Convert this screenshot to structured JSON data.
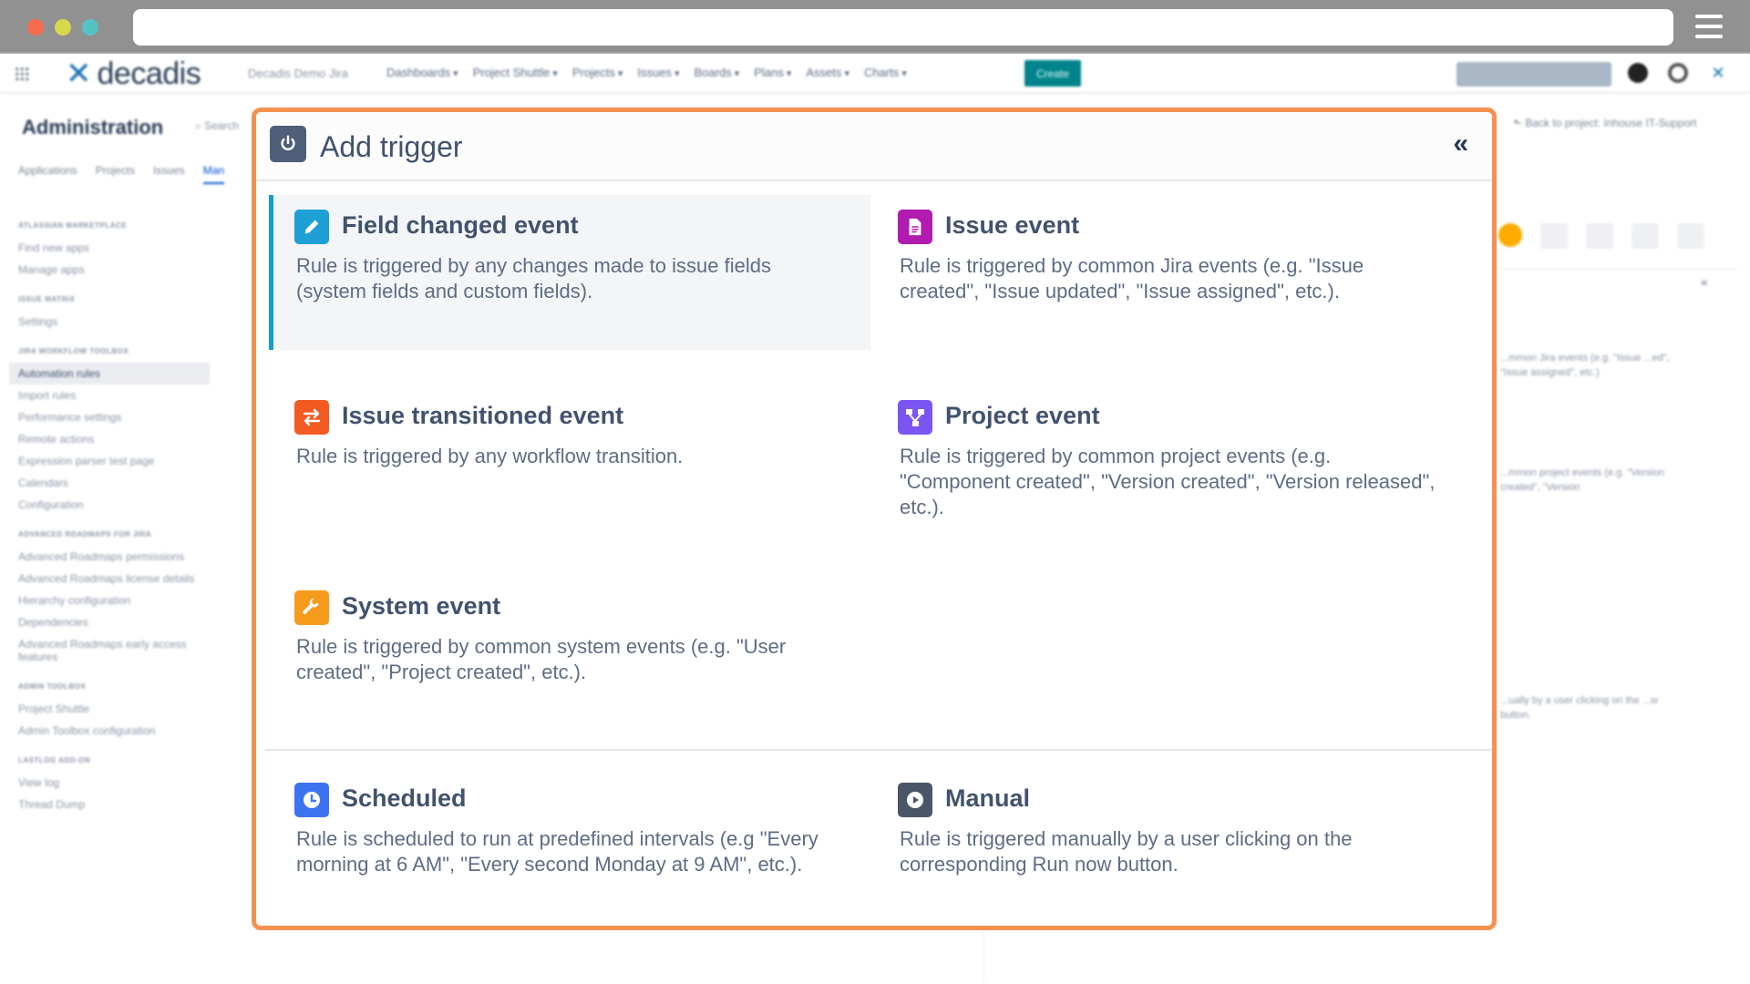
{
  "app": {
    "logo_text": "decadis",
    "instance_label": "Decadis Demo Jira",
    "nav": [
      "Dashboards",
      "Project Shuttle",
      "Projects",
      "Issues",
      "Boards",
      "Plans",
      "Assets",
      "Charts"
    ],
    "create_label": "Create"
  },
  "admin": {
    "title": "Administration",
    "search_label": "Search",
    "tabs": [
      "Applications",
      "Projects",
      "Issues",
      "Man"
    ],
    "back_link": "Back to project: Inhouse IT-Support",
    "sidebar": [
      {
        "section": "Atlassian Marketplace",
        "items": [
          "Find new apps",
          "Manage apps"
        ]
      },
      {
        "section": "Issue Matrix",
        "items": [
          "Settings"
        ]
      },
      {
        "section": "Jira Workflow Toolbox",
        "items": [
          "Automation rules",
          "Import rules",
          "Performance settings",
          "Remote actions",
          "Expression parser test page",
          "Calendars",
          "Configuration"
        ]
      },
      {
        "section": "Advanced Roadmaps for Jira",
        "items": [
          "Advanced Roadmaps permissions",
          "Advanced Roadmaps license details",
          "Hierarchy configuration",
          "Dependencies",
          "Advanced Roadmaps early access features"
        ]
      },
      {
        "section": "Admin Toolbox",
        "items": [
          "Project Shuttle",
          "Admin Toolbox configuration"
        ]
      },
      {
        "section": "Lastlog Add-on",
        "items": [
          "View log",
          "Thread Dump"
        ]
      }
    ],
    "right_texts": [
      "...mmon Jira events (e.g. \"Issue ...ed\", \"Issue assigned\", etc.)",
      "...mmon project events (e.g. \"Version created\", \"Version",
      "...ually by a user clicking on the ...w button."
    ]
  },
  "modal": {
    "title": "Add trigger",
    "collapse_icon": "chevrons-left-icon",
    "triggers": [
      {
        "key": "field-changed",
        "title": "Field changed event",
        "description": "Rule is triggered by any changes made to issue fields (system fields and custom fields).",
        "color": "#1fa0d4",
        "icon": "pencil-icon",
        "selected": true
      },
      {
        "key": "issue",
        "title": "Issue event",
        "description": "Rule is triggered by common Jira events (e.g. \"Issue created\", \"Issue updated\", \"Issue assigned\", etc.).",
        "color": "#b11bb0",
        "icon": "document-icon",
        "selected": false
      },
      {
        "key": "issue-transitioned",
        "title": "Issue transitioned event",
        "description": "Rule is triggered by any workflow transition.",
        "color": "#f25a22",
        "icon": "transition-arrows-icon",
        "selected": false
      },
      {
        "key": "project",
        "title": "Project event",
        "description": "Rule is triggered by common project events (e.g. \"Component created\", \"Version created\", \"Version released\", etc.).",
        "color": "#7a55f2",
        "icon": "hierarchy-icon",
        "selected": false
      },
      {
        "key": "system",
        "title": "System event",
        "description": "Rule is triggered by common system events (e.g. \"User created\", \"Project created\", etc.).",
        "color": "#f79b1d",
        "icon": "wrench-icon",
        "selected": false
      },
      {
        "key": "scheduled",
        "title": "Scheduled",
        "description": "Rule is scheduled to run at predefined intervals (e.g \"Every morning at 6 AM\", \"Every second Monday at 9 AM\", etc.).",
        "color": "#3c73f0",
        "icon": "clock-icon",
        "selected": false
      },
      {
        "key": "manual",
        "title": "Manual",
        "description": "Rule is triggered manually by a user clicking on the corresponding Run now button.",
        "color": "#4a5568",
        "icon": "play-icon",
        "selected": false
      }
    ]
  }
}
